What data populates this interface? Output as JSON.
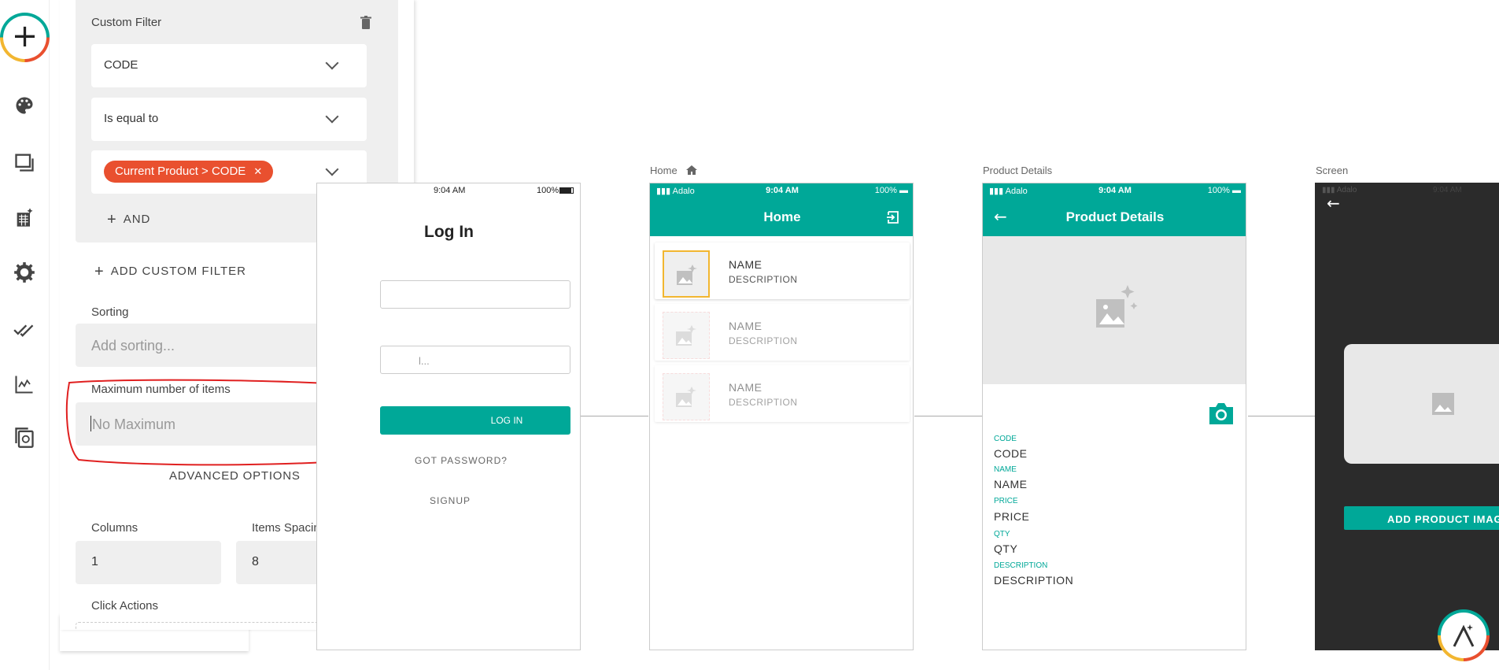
{
  "toolbar": {
    "add_symbol": "+",
    "icons": [
      "palette-icon",
      "screens-icon",
      "database-icon",
      "gear-icon",
      "publish-icon",
      "analytics-icon",
      "copy-icon"
    ]
  },
  "panel": {
    "custom_filter_title": "Custom Filter",
    "filter_field": "CODE",
    "filter_operator": "Is equal to",
    "filter_value_pill": "Current Product > CODE",
    "and_label": "AND",
    "add_custom_filter_label": "ADD CUSTOM FILTER",
    "sorting_label": "Sorting",
    "sorting_placeholder": "Add sorting...",
    "max_items_label": "Maximum number of items",
    "max_items_placeholder": "No Maximum",
    "advanced_options_label": "ADVANCED OPTIONS",
    "columns_label": "Columns",
    "columns_value": "1",
    "spacing_label": "Items Spacing",
    "spacing_value": "8",
    "click_actions_label": "Click Actions"
  },
  "login_screen": {
    "time": "9:04 AM",
    "battery": "100%",
    "title": "Log In",
    "password_partial": "l...",
    "login_button": "LOG IN",
    "forgot_password": "GOT PASSWORD?",
    "signup": "SIGNUP"
  },
  "home_screen": {
    "label": "Home",
    "carrier": "Adalo",
    "time": "9:04 AM",
    "battery": "100%",
    "title": "Home",
    "items": [
      {
        "name": "NAME",
        "description": "DESCRIPTION"
      },
      {
        "name": "NAME",
        "description": "DESCRIPTION"
      },
      {
        "name": "NAME",
        "description": "DESCRIPTION"
      }
    ]
  },
  "details_screen": {
    "label": "Product Details",
    "carrier": "Adalo",
    "time": "9:04 AM",
    "battery": "100%",
    "title": "Product Details",
    "fields": [
      {
        "key": "CODE",
        "value": "CODE"
      },
      {
        "key": "NAME",
        "value": "NAME"
      },
      {
        "key": "PRICE",
        "value": "PRICE"
      },
      {
        "key": "QTY",
        "value": "QTY"
      },
      {
        "key": "DESCRIPTION",
        "value": "DESCRIPTION"
      }
    ]
  },
  "image_screen": {
    "label": "Screen",
    "carrier": "Adalo",
    "time": "9:04 AM",
    "button": "ADD PRODUCT IMAG"
  },
  "colors": {
    "accent": "#00a898",
    "pill": "#e9502f",
    "annotation": "#e02020"
  }
}
